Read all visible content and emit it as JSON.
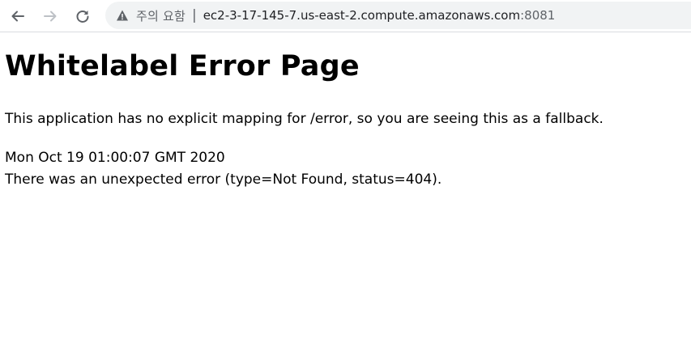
{
  "browser": {
    "security_label": "주의 요함",
    "separator": "|",
    "url_host": "ec2-3-17-145-7.us-east-2.compute.amazonaws.com",
    "url_port": ":8081",
    "icons": {
      "back": "arrow-left-icon",
      "forward": "arrow-right-icon",
      "reload": "reload-icon",
      "security": "warning-triangle-icon"
    }
  },
  "page": {
    "title": "Whitelabel Error Page",
    "description": "This application has no explicit mapping for /error, so you are seeing this as a fallback.",
    "timestamp": "Mon Oct 19 01:00:07 GMT 2020",
    "error_message": "There was an unexpected error (type=Not Found, status=404)."
  }
}
